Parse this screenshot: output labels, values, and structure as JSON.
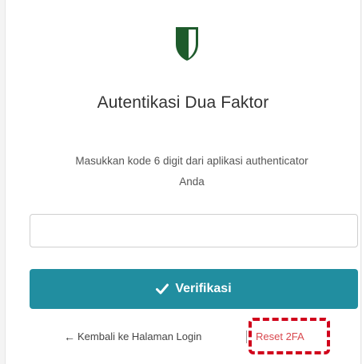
{
  "auth": {
    "title": "Autentikasi Dua Faktor",
    "subtitle_line1": "Masukkan kode 6 digit dari aplikasi authenticator",
    "subtitle_line2": "Anda",
    "code_input": {
      "value": "",
      "placeholder": ""
    },
    "verify_label": "Verifikasi",
    "back_label": "Kembali ke Halaman Login",
    "reset_label": "Reset 2FA"
  },
  "icons": {
    "logo": "shield-icon",
    "verify": "check-icon",
    "back": "arrow-left-icon"
  },
  "colors": {
    "brand_green": "#1e5b2c",
    "button_teal": "#218ea0",
    "reset_red": "#d9484e",
    "highlight_red": "#d0021b"
  }
}
